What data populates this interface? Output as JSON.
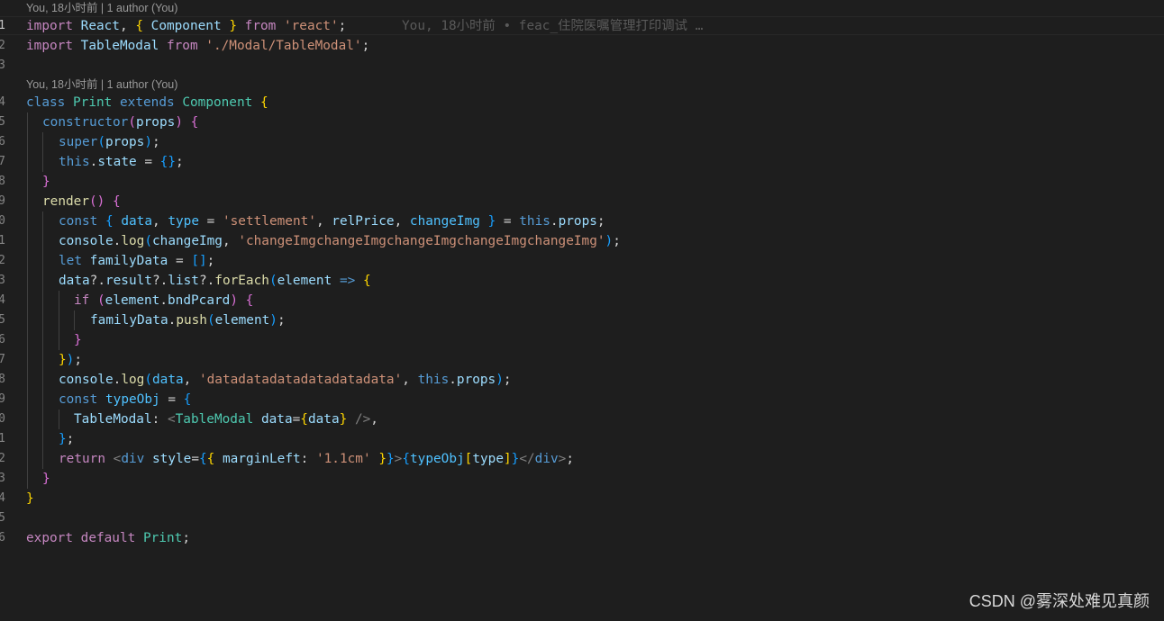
{
  "codelens": [
    "You, 18小时前 | 1 author (You)",
    "You, 18小时前 | 1 author (You)"
  ],
  "inline_blame": "You, 18小时前 • feac_住院医嘱管理打印调试 …",
  "line_numbers": [
    "1",
    "2",
    "3",
    "4",
    "5",
    "6",
    "7",
    "8",
    "9",
    "0",
    "1",
    "2",
    "3",
    "4",
    "5",
    "6",
    "7",
    "8",
    "9",
    "0",
    "1",
    "2",
    "3",
    "4",
    "5",
    "6"
  ],
  "code": {
    "l1": [
      "import",
      " ",
      "React",
      ", ",
      "{",
      " ",
      "Component",
      " ",
      "}",
      " ",
      "from",
      " ",
      "'react'",
      ";"
    ],
    "l2": [
      "import",
      " ",
      "TableModal",
      " ",
      "from",
      " ",
      "'./Modal/TableModal'",
      ";"
    ],
    "l4": [
      "class",
      " ",
      "Print",
      " ",
      "extends",
      " ",
      "Component",
      " ",
      "{"
    ],
    "l5": [
      "constructor",
      "(",
      "props",
      ")",
      " ",
      "{"
    ],
    "l6": [
      "super",
      "(",
      "props",
      ")",
      ";"
    ],
    "l7": [
      "this",
      ".",
      "state",
      " = ",
      "{}",
      ";"
    ],
    "l8": [
      "}"
    ],
    "l9": [
      "render",
      "()",
      " ",
      "{"
    ],
    "l10": [
      "const",
      " ",
      "{",
      " ",
      "data",
      ", ",
      "type",
      " = ",
      "'settlement'",
      ", ",
      "relPrice",
      ", ",
      "changeImg",
      " ",
      "}",
      " = ",
      "this",
      ".",
      "props",
      ";"
    ],
    "l11": [
      "console",
      ".",
      "log",
      "(",
      "changeImg",
      ", ",
      "'changeImgchangeImgchangeImgchangeImgchangeImg'",
      ")",
      ";"
    ],
    "l12": [
      "let",
      " ",
      "familyData",
      " = ",
      "[]",
      ";"
    ],
    "l13": [
      "data",
      "?.",
      "result",
      "?.",
      "list",
      "?.",
      "forEach",
      "(",
      "element",
      " ",
      "=>",
      " ",
      "{"
    ],
    "l14": [
      "if",
      " ",
      "(",
      "element",
      ".",
      "bndPcard",
      ")",
      " ",
      "{"
    ],
    "l15": [
      "familyData",
      ".",
      "push",
      "(",
      "element",
      ")",
      ";"
    ],
    "l16": [
      "}"
    ],
    "l17": [
      "}",
      ")",
      ";"
    ],
    "l18": [
      "console",
      ".",
      "log",
      "(",
      "data",
      ", ",
      "'datadatadatadatadatadata'",
      ", ",
      "this",
      ".",
      "props",
      ")",
      ";"
    ],
    "l19": [
      "const",
      " ",
      "typeObj",
      " = ",
      "{"
    ],
    "l20": [
      "TableModal",
      ": ",
      "<",
      "TableModal",
      " ",
      "data",
      "=",
      "{",
      "data",
      "}",
      " ",
      "/>",
      ","
    ],
    "l21": [
      "}",
      ";"
    ],
    "l22": [
      "return",
      " ",
      "<",
      "div",
      " ",
      "style",
      "=",
      "{",
      "{",
      " ",
      "marginLeft",
      ": ",
      "'1.1cm'",
      " ",
      "}",
      "}",
      ">",
      "{",
      "typeObj",
      "[",
      "type",
      "]",
      "}",
      "</",
      "div",
      ">",
      ";"
    ],
    "l23": [
      "}"
    ],
    "l24": [
      "}"
    ],
    "l26": [
      "export",
      " ",
      "default",
      " ",
      "Print",
      ";"
    ]
  },
  "watermark": "CSDN @雾深处难见真颜",
  "colors": {
    "background": "#1e1e1e",
    "keyword": "#569cd6",
    "control": "#c586c0",
    "class": "#4ec9b0",
    "variable": "#9cdcfe",
    "function": "#dcdcaa",
    "string": "#ce9178",
    "bracket_gold": "#ffd700",
    "bracket_orchid": "#da70d6",
    "bracket_blue": "#179fff"
  }
}
